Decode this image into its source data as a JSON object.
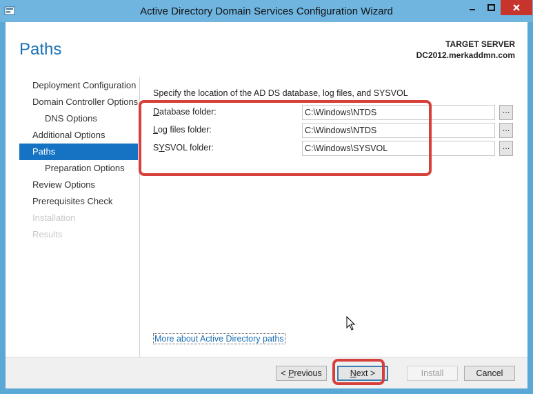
{
  "window": {
    "title": "Active Directory Domain Services Configuration Wizard",
    "colors": {
      "titlebar": "#6fb5e0",
      "close": "#c7342c",
      "accent": "#1673c4",
      "highlight": "#d6403a"
    }
  },
  "header": {
    "page_title": "Paths",
    "target_label": "TARGET SERVER",
    "target_value": "DC2012.merkaddmn.com"
  },
  "nav": {
    "items": [
      {
        "label": "Deployment Configuration",
        "state": "normal"
      },
      {
        "label": "Domain Controller Options",
        "state": "normal"
      },
      {
        "label": "DNS Options",
        "state": "normal"
      },
      {
        "label": "Additional Options",
        "state": "normal"
      },
      {
        "label": "Paths",
        "state": "active"
      },
      {
        "label": "Preparation Options",
        "state": "normal"
      },
      {
        "label": "Review Options",
        "state": "normal"
      },
      {
        "label": "Prerequisites Check",
        "state": "normal"
      },
      {
        "label": "Installation",
        "state": "disabled"
      },
      {
        "label": "Results",
        "state": "disabled"
      }
    ]
  },
  "content": {
    "intro": "Specify the location of the AD DS database, log files, and SYSVOL",
    "fields": [
      {
        "label_u": "D",
        "label_rest": "atabase folder:",
        "value": "C:\\Windows\\NTDS",
        "browse": "..."
      },
      {
        "label_u": "L",
        "label_rest": "og files folder:",
        "value": "C:\\Windows\\NTDS",
        "browse": "..."
      },
      {
        "label_pre": "S",
        "label_u": "Y",
        "label_rest": "SVOL folder:",
        "value": "C:\\Windows\\SYSVOL",
        "browse": "..."
      }
    ],
    "more_link": "More about Active Directory paths"
  },
  "footer": {
    "previous": {
      "prefix": "< ",
      "u": "P",
      "rest": "revious"
    },
    "next": {
      "u": "N",
      "rest": "ext >"
    },
    "install": "Install",
    "cancel": "Cancel"
  }
}
